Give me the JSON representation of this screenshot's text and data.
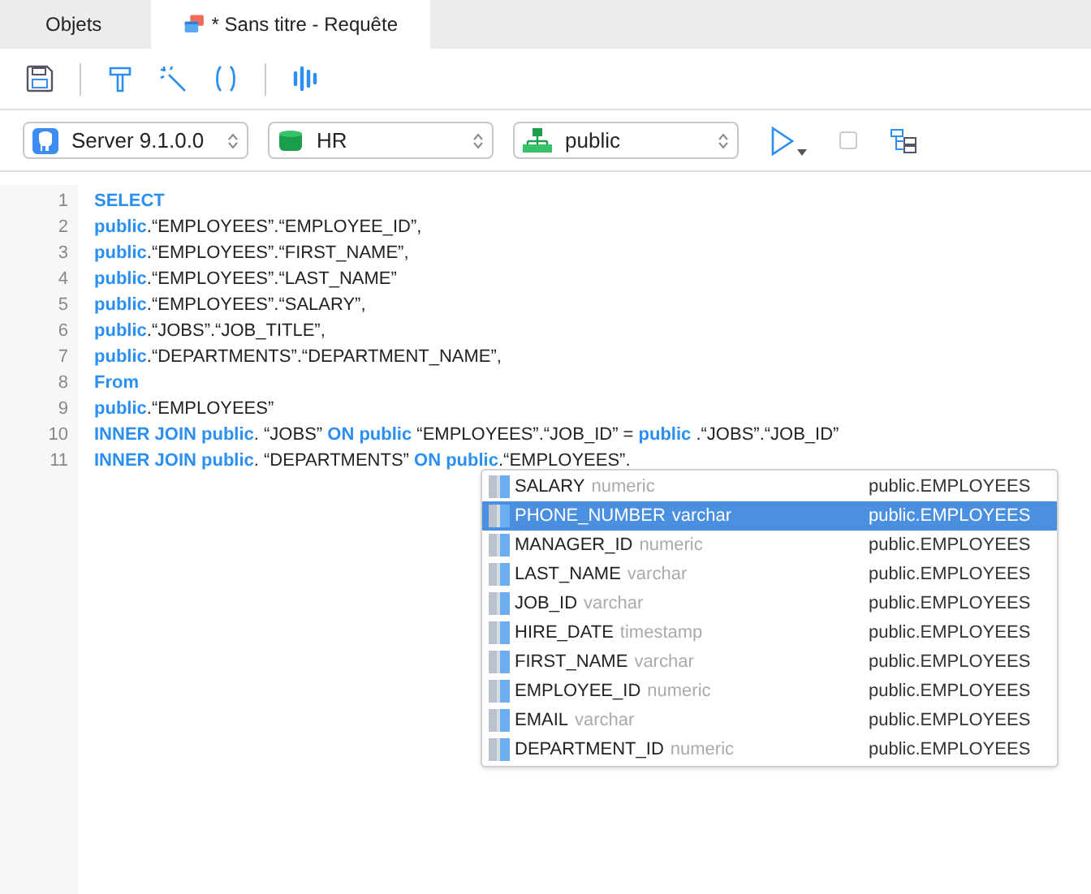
{
  "tabs": [
    {
      "label": "Objets",
      "selected": false,
      "icon": false
    },
    {
      "label": "* Sans titre - Requête",
      "selected": true,
      "icon": true
    }
  ],
  "selectors": [
    {
      "kind": "server",
      "value": "Server 9.1.0.0"
    },
    {
      "kind": "database",
      "value": "HR"
    },
    {
      "kind": "schema",
      "value": "public"
    }
  ],
  "editor": {
    "lines": [
      {
        "number": "1",
        "tokens": [
          {
            "kind": "kw",
            "text": "SELECT"
          }
        ]
      },
      {
        "number": "2",
        "tokens": [
          {
            "kind": "kw",
            "text": "public"
          },
          {
            "kind": "text",
            "text": ".“EMPLOYEES”.“EMPLOYEE_ID”,"
          }
        ]
      },
      {
        "number": "3",
        "tokens": [
          {
            "kind": "kw",
            "text": "public"
          },
          {
            "kind": "text",
            "text": ".“EMPLOYEES”.“FIRST_NAME”,"
          }
        ]
      },
      {
        "number": "4",
        "tokens": [
          {
            "kind": "kw",
            "text": "public"
          },
          {
            "kind": "text",
            "text": ".“EMPLOYEES”.“LAST_NAME”"
          }
        ]
      },
      {
        "number": "5",
        "tokens": [
          {
            "kind": "kw",
            "text": "public"
          },
          {
            "kind": "text",
            "text": ".“EMPLOYEES”.“SALARY”,"
          }
        ]
      },
      {
        "number": "6",
        "tokens": [
          {
            "kind": "kw",
            "text": "public"
          },
          {
            "kind": "text",
            "text": ".“JOBS”.“JOB_TITLE”,"
          }
        ]
      },
      {
        "number": "7",
        "tokens": [
          {
            "kind": "kw",
            "text": "public"
          },
          {
            "kind": "text",
            "text": ".“DEPARTMENTS”.“DEPARTMENT_NAME”,"
          }
        ]
      },
      {
        "number": "8",
        "tokens": [
          {
            "kind": "kw",
            "text": "From"
          }
        ]
      },
      {
        "number": "9",
        "tokens": [
          {
            "kind": "kw",
            "text": "public"
          },
          {
            "kind": "text",
            "text": ".“EMPLOYEES”"
          }
        ]
      },
      {
        "number": "10",
        "tokens": [
          {
            "kind": "kw",
            "text": "INNER JOIN public"
          },
          {
            "kind": "text",
            "text": ". “JOBS” "
          },
          {
            "kind": "kw",
            "text": "ON public"
          },
          {
            "kind": "text",
            "text": " “EMPLOYEES”.“JOB_ID” = "
          },
          {
            "kind": "kw",
            "text": "public"
          },
          {
            "kind": "text",
            "text": " .“JOBS”.“JOB_ID”"
          }
        ]
      },
      {
        "number": "11",
        "tokens": [
          {
            "kind": "kw",
            "text": "INNER JOIN public"
          },
          {
            "kind": "text",
            "text": ". “DEPARTMENTS” "
          },
          {
            "kind": "kw",
            "text": "ON public"
          },
          {
            "kind": "text",
            "text": ".“EMPLOYEES”."
          }
        ]
      }
    ]
  },
  "autocomplete": [
    {
      "name": "SALARY",
      "type": "numeric",
      "table": "public.EMPLOYEES",
      "selected": false
    },
    {
      "name": "PHONE_NUMBER",
      "type": "varchar",
      "table": "public.EMPLOYEES",
      "selected": true
    },
    {
      "name": "MANAGER_ID",
      "type": "numeric",
      "table": "public.EMPLOYEES",
      "selected": false
    },
    {
      "name": "LAST_NAME",
      "type": "varchar",
      "table": "public.EMPLOYEES",
      "selected": false
    },
    {
      "name": "JOB_ID",
      "type": "varchar",
      "table": "public.EMPLOYEES",
      "selected": false
    },
    {
      "name": "HIRE_DATE",
      "type": "timestamp",
      "table": "public.EMPLOYEES",
      "selected": false
    },
    {
      "name": "FIRST_NAME",
      "type": "varchar",
      "table": "public.EMPLOYEES",
      "selected": false
    },
    {
      "name": "EMPLOYEE_ID",
      "type": "numeric",
      "table": "public.EMPLOYEES",
      "selected": false
    },
    {
      "name": "EMAIL",
      "type": "varchar",
      "table": "public.EMPLOYEES",
      "selected": false
    },
    {
      "name": "DEPARTMENT_ID",
      "type": "numeric",
      "table": "public.EMPLOYEES",
      "selected": false
    }
  ]
}
